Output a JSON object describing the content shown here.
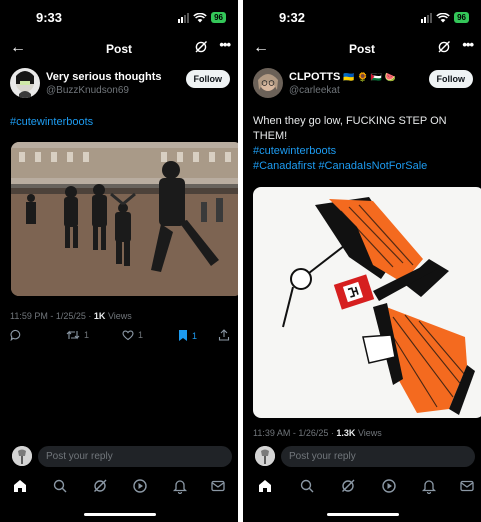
{
  "left": {
    "status": {
      "time": "9:33",
      "battery": "96"
    },
    "nav": {
      "title": "Post"
    },
    "author": {
      "name": "Very serious thoughts",
      "handle": "@BuzzKnudson69",
      "follow_label": "Follow"
    },
    "hashtag": "#cutewinterboots",
    "meta": {
      "time": "11:59 PM",
      "date": "1/25/25",
      "views": "1K",
      "views_label": "Views"
    },
    "stats": {
      "retweets": "1",
      "likes": "1",
      "bookmarks": "1"
    },
    "reply_placeholder": "Post your reply"
  },
  "right": {
    "status": {
      "time": "9:32",
      "battery": "96"
    },
    "nav": {
      "title": "Post"
    },
    "author": {
      "name": "CLPOTTS",
      "flags": "🇺🇦 🌻 🇵🇸 🍉",
      "handle": "@carleekat",
      "follow_label": "Follow"
    },
    "text": "When they go low, FUCKING STEP ON THEM!",
    "hashtags": [
      "#cutewinterboots",
      "#Canadafirst",
      "#CanadaIsNotForSale"
    ],
    "meta": {
      "time": "11:39 AM",
      "date": "1/26/25",
      "views": "1.3K",
      "views_label": "Views"
    },
    "reply_placeholder": "Post your reply"
  },
  "meta_sep": "·",
  "meta_date_sep": " - ",
  "icons": [
    "back-arrow-icon",
    "grok-icon",
    "more-icon",
    "reply-icon",
    "retweet-icon",
    "like-icon",
    "bookmark-icon",
    "share-icon",
    "home-icon",
    "search-icon",
    "grok-tab-icon",
    "video-icon",
    "notifications-icon",
    "messages-icon"
  ],
  "colors": {
    "background": "#000000",
    "text": "#e7e9ea",
    "secondary": "#71767b",
    "link": "#1d9bf0",
    "bookmark_active": "#1d9bf0",
    "battery": "#34c759"
  }
}
